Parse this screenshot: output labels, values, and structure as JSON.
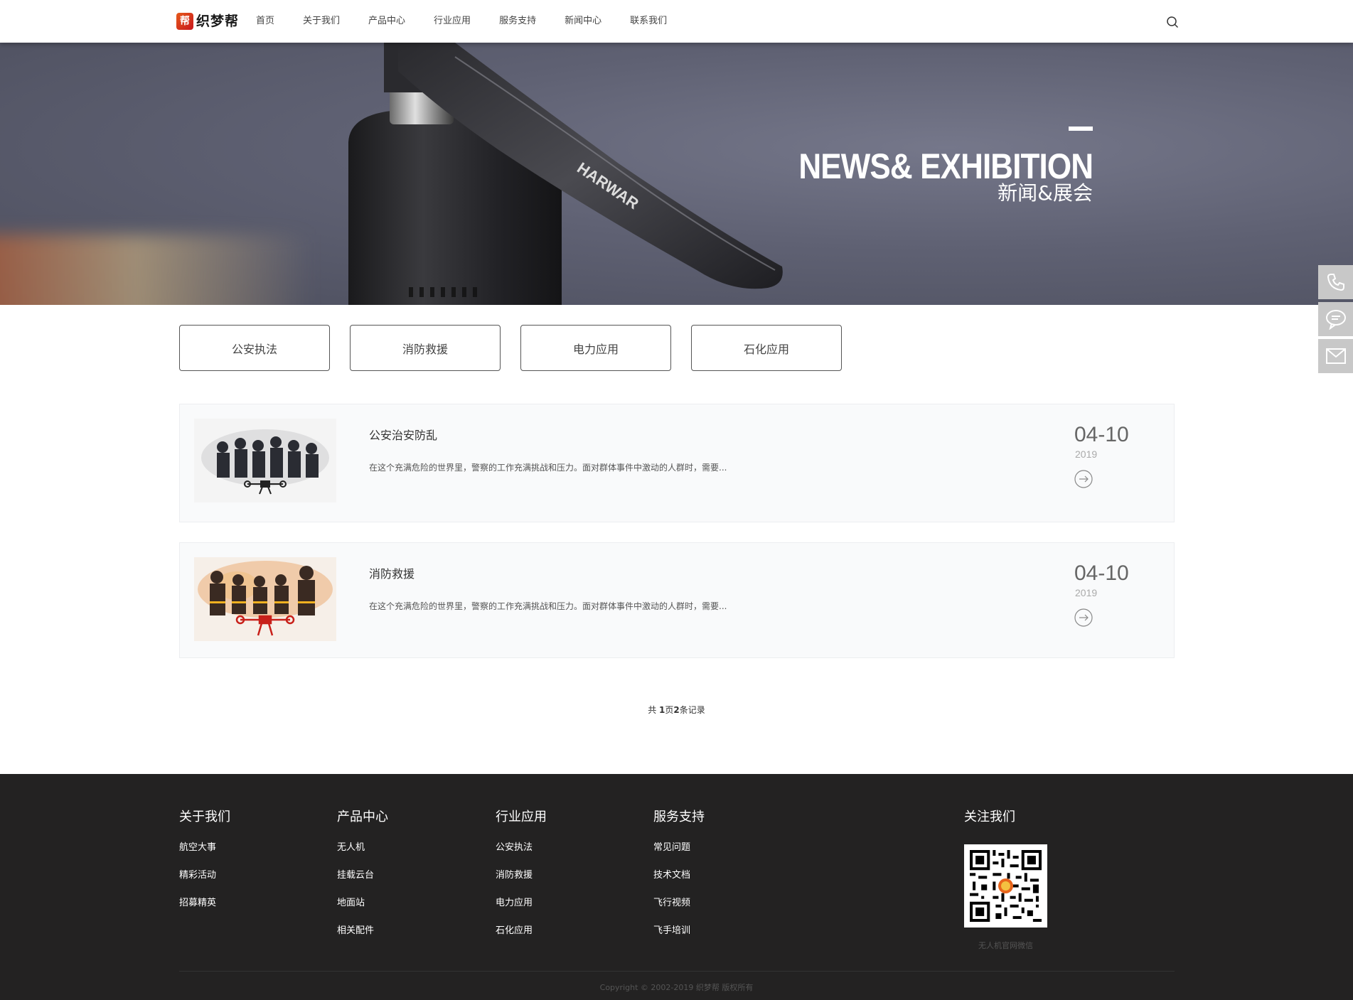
{
  "header": {
    "logo_mark": "帮",
    "logo_text": "织梦帮",
    "nav": [
      "首页",
      "关于我们",
      "产品中心",
      "行业应用",
      "服务支持",
      "新闻中心",
      "联系我们"
    ]
  },
  "banner": {
    "title_en": "NEWS& EXHIBITION",
    "title_cn": "新闻&展会",
    "prop_brand": "HARWAR"
  },
  "tabs": [
    "公安执法",
    "消防救援",
    "电力应用",
    "石化应用"
  ],
  "news": [
    {
      "title": "公安治安防乱",
      "desc": "在这个充满危险的世界里，警察的工作充满挑战和压力。面对群体事件中激动的人群时，需要...",
      "date": "04-10",
      "year": "2019"
    },
    {
      "title": "消防救援",
      "desc": "在这个充满危险的世界里，警察的工作充满挑战和压力。面对群体事件中激动的人群时，需要...",
      "date": "04-10",
      "year": "2019"
    }
  ],
  "pager": {
    "prefix": "共 ",
    "pages": "1",
    "mid": "页",
    "records": "2",
    "suffix": "条记录"
  },
  "footer": {
    "columns": [
      {
        "title": "关于我们",
        "links": [
          "航空大事",
          "精彩活动",
          "招募精英"
        ]
      },
      {
        "title": "产品中心",
        "links": [
          "无人机",
          "挂载云台",
          "地面站",
          "相关配件"
        ]
      },
      {
        "title": "行业应用",
        "links": [
          "公安执法",
          "消防救援",
          "电力应用",
          "石化应用"
        ]
      },
      {
        "title": "服务支持",
        "links": [
          "常见问题",
          "技术文档",
          "飞行视频",
          "飞手培训"
        ]
      }
    ],
    "follow_title": "关注我们",
    "qr_caption": "无人机官网微信",
    "copyright": "Copyright © 2002-2019 织梦帮 版权所有"
  },
  "side_bar": [
    "phone-icon",
    "chat-icon",
    "mail-icon"
  ],
  "colors": {
    "footer_bg": "#232222",
    "banner_bg": "#5f6173",
    "side_btn": "#c8c8c8"
  }
}
